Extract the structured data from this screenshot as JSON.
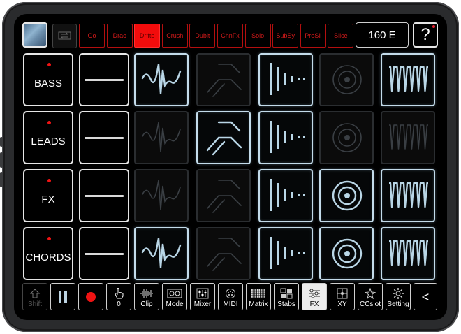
{
  "scenes": [
    "Go",
    "Drac",
    "Drifte",
    "Crush",
    "Dublt",
    "ChnFx",
    "Solo",
    "SubSy",
    "PreSli",
    "Slice"
  ],
  "active_scene": "Drifte",
  "tempo": "160 E",
  "help_label": "?",
  "tracks": [
    {
      "name": "BASS"
    },
    {
      "name": "LEADS"
    },
    {
      "name": "FX"
    },
    {
      "name": "CHORDS"
    }
  ],
  "fx_columns": [
    "wave",
    "envelope",
    "bars",
    "rings",
    "comb"
  ],
  "grid_on": [
    [
      true,
      false,
      true,
      false,
      true
    ],
    [
      false,
      true,
      true,
      false,
      false
    ],
    [
      false,
      false,
      true,
      true,
      true
    ],
    [
      true,
      false,
      true,
      true,
      true
    ]
  ],
  "toolbar": {
    "shift": "Shift",
    "pause": "",
    "record": "",
    "hand": "0",
    "clip": "Clip",
    "mode": "Mode",
    "mixer": "Mixer",
    "midi": "MIDI",
    "matrix": "Matrix",
    "stabs": "Stabs",
    "fx": "FX",
    "xy": "XY",
    "ccslot": "CCslot",
    "setting": "Setting",
    "back": "<"
  },
  "colors": {
    "scene_red": "#d41a1a",
    "scene_active": "#f20c0c",
    "glow": "#c3dbea"
  }
}
